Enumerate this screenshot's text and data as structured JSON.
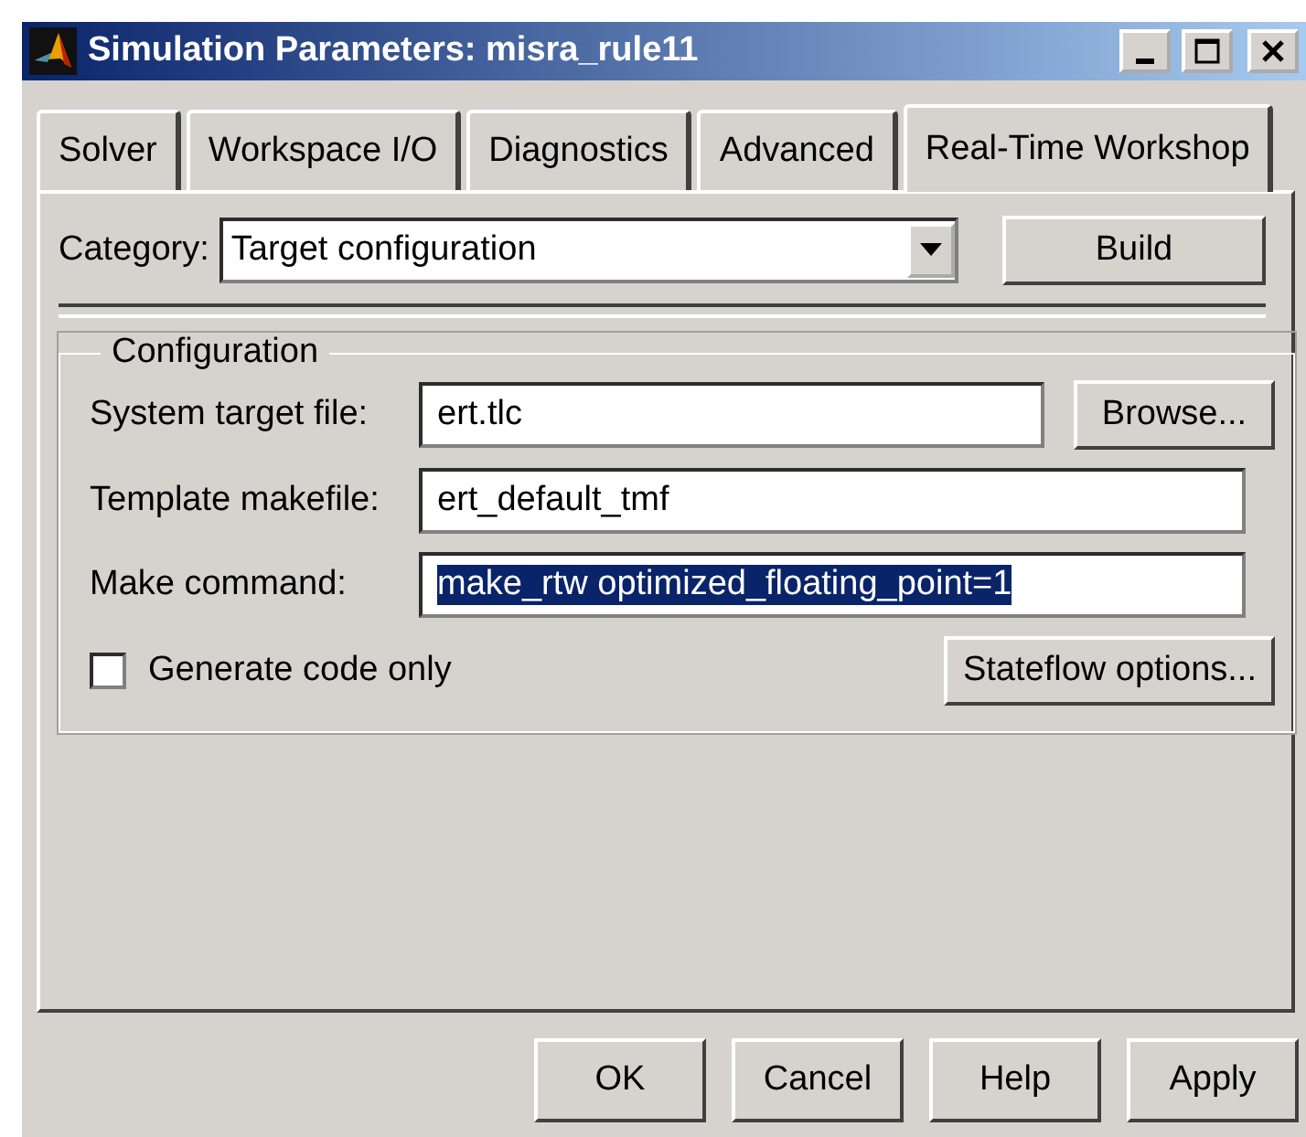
{
  "window": {
    "title": "Simulation Parameters: misra_rule11"
  },
  "tabs": [
    {
      "label": "Solver",
      "selected": false
    },
    {
      "label": "Workspace I/O",
      "selected": false
    },
    {
      "label": "Diagnostics",
      "selected": false
    },
    {
      "label": "Advanced",
      "selected": false
    },
    {
      "label": "Real-Time Workshop",
      "selected": true
    }
  ],
  "category": {
    "label": "Category:",
    "value": "Target configuration",
    "button": "Build"
  },
  "configuration": {
    "title": "Configuration",
    "fields": [
      {
        "label": "System target file:",
        "value": "ert.tlc",
        "text_selected": false,
        "button": "Browse..."
      },
      {
        "label": "Template makefile:",
        "value": "ert_default_tmf",
        "text_selected": false
      },
      {
        "label": "Make command:",
        "value": "make_rtw optimized_floating_point=1",
        "text_selected": true
      }
    ],
    "checkbox": {
      "label": "Generate code only",
      "checked": false
    },
    "button": "Stateflow options..."
  },
  "buttons": [
    "OK",
    "Cancel",
    "Help",
    "Apply"
  ]
}
